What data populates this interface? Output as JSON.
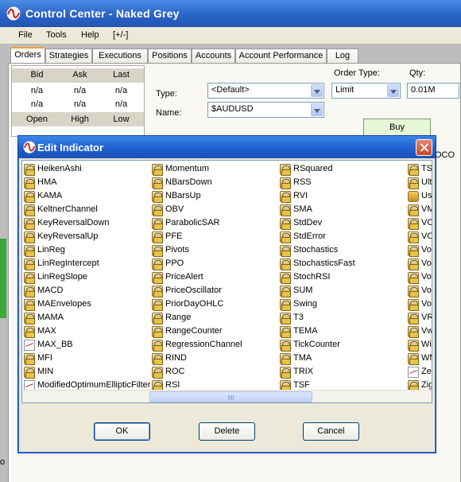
{
  "app": {
    "title": "Control Center - Naked Grey"
  },
  "menu": [
    "File",
    "Tools",
    "Help",
    "[+/-]"
  ],
  "tabs": [
    "Orders",
    "Strategies",
    "Executions",
    "Positions",
    "Accounts",
    "Account Performance",
    "Log"
  ],
  "quote": {
    "headers_top": [
      "Bid",
      "Ask",
      "Last"
    ],
    "values_top": [
      "n/a",
      "n/a",
      "n/a"
    ],
    "values_mid": [
      "n/a",
      "n/a",
      "n/a"
    ],
    "headers_bottom": [
      "Open",
      "High",
      "Low"
    ]
  },
  "order": {
    "type_label": "Type:",
    "type_value": "<Default>",
    "name_label": "Name:",
    "name_value": "$AUDUSD",
    "order_type_label": "Order Type:",
    "order_type_value": "Limit",
    "qty_label": "Qty:",
    "qty_value": "0.01M",
    "buy_label": "Buy",
    "oco_label": "OCO"
  },
  "dialog": {
    "title": "Edit Indicator",
    "columns": [
      [
        {
          "label": "HeikenAshi",
          "icon": "lock-icon"
        },
        {
          "label": "HMA",
          "icon": "lock-icon"
        },
        {
          "label": "KAMA",
          "icon": "lock-icon"
        },
        {
          "label": "KeltnerChannel",
          "icon": "lock-icon"
        },
        {
          "label": "KeyReversalDown",
          "icon": "lock-icon"
        },
        {
          "label": "KeyReversalUp",
          "icon": "lock-icon"
        },
        {
          "label": "LinReg",
          "icon": "lock-icon"
        },
        {
          "label": "LinRegIntercept",
          "icon": "lock-icon"
        },
        {
          "label": "LinRegSlope",
          "icon": "lock-icon"
        },
        {
          "label": "MACD",
          "icon": "lock-icon"
        },
        {
          "label": "MAEnvelopes",
          "icon": "lock-icon"
        },
        {
          "label": "MAMA",
          "icon": "lock-icon"
        },
        {
          "label": "MAX",
          "icon": "lock-icon"
        },
        {
          "label": "MAX_BB",
          "icon": "chart-icon"
        },
        {
          "label": "MFI",
          "icon": "lock-icon"
        },
        {
          "label": "MIN",
          "icon": "lock-icon"
        },
        {
          "label": "ModifiedOptimumEllipticFilter",
          "icon": "chart-icon"
        }
      ],
      [
        {
          "label": "Momentum",
          "icon": "lock-icon"
        },
        {
          "label": "NBarsDown",
          "icon": "lock-icon"
        },
        {
          "label": "NBarsUp",
          "icon": "lock-icon"
        },
        {
          "label": "OBV",
          "icon": "lock-icon"
        },
        {
          "label": "ParabolicSAR",
          "icon": "lock-icon"
        },
        {
          "label": "PFE",
          "icon": "lock-icon"
        },
        {
          "label": "Pivots",
          "icon": "lock-icon"
        },
        {
          "label": "PPO",
          "icon": "lock-icon"
        },
        {
          "label": "PriceAlert",
          "icon": "lock-icon"
        },
        {
          "label": "PriceOscillator",
          "icon": "lock-icon"
        },
        {
          "label": "PriorDayOHLC",
          "icon": "lock-icon"
        },
        {
          "label": "Range",
          "icon": "lock-icon"
        },
        {
          "label": "RangeCounter",
          "icon": "lock-icon"
        },
        {
          "label": "RegressionChannel",
          "icon": "lock-icon"
        },
        {
          "label": "RIND",
          "icon": "lock-icon"
        },
        {
          "label": "ROC",
          "icon": "lock-icon"
        },
        {
          "label": "RSI",
          "icon": "lock-icon"
        }
      ],
      [
        {
          "label": "RSquared",
          "icon": "lock-icon"
        },
        {
          "label": "RSS",
          "icon": "lock-icon"
        },
        {
          "label": "RVI",
          "icon": "lock-icon"
        },
        {
          "label": "SMA",
          "icon": "lock-icon"
        },
        {
          "label": "StdDev",
          "icon": "lock-icon"
        },
        {
          "label": "StdError",
          "icon": "lock-icon"
        },
        {
          "label": "Stochastics",
          "icon": "lock-icon"
        },
        {
          "label": "StochasticsFast",
          "icon": "lock-icon"
        },
        {
          "label": "StochRSI",
          "icon": "lock-icon"
        },
        {
          "label": "SUM",
          "icon": "lock-icon"
        },
        {
          "label": "Swing",
          "icon": "lock-icon"
        },
        {
          "label": "T3",
          "icon": "lock-icon"
        },
        {
          "label": "TEMA",
          "icon": "lock-icon"
        },
        {
          "label": "TickCounter",
          "icon": "lock-icon"
        },
        {
          "label": "TMA",
          "icon": "lock-icon"
        },
        {
          "label": "TRIX",
          "icon": "lock-icon"
        },
        {
          "label": "TSF",
          "icon": "lock-icon"
        }
      ],
      [
        {
          "label": "TSI",
          "icon": "lock-icon"
        },
        {
          "label": "Ulti",
          "icon": "lock-icon"
        },
        {
          "label": "Use",
          "icon": "user-icon"
        },
        {
          "label": "VM",
          "icon": "lock-icon"
        },
        {
          "label": "VO",
          "icon": "lock-icon"
        },
        {
          "label": "VO",
          "icon": "lock-icon"
        },
        {
          "label": "Vol",
          "icon": "lock-icon"
        },
        {
          "label": "Vol",
          "icon": "lock-icon"
        },
        {
          "label": "Vol",
          "icon": "lock-icon"
        },
        {
          "label": "Vol",
          "icon": "lock-icon"
        },
        {
          "label": "Vol",
          "icon": "lock-icon"
        },
        {
          "label": "VR",
          "icon": "lock-icon"
        },
        {
          "label": "Vw",
          "icon": "lock-icon"
        },
        {
          "label": "Wil",
          "icon": "lock-icon"
        },
        {
          "label": "WM",
          "icon": "lock-icon"
        },
        {
          "label": "Zer",
          "icon": "chart-icon"
        },
        {
          "label": "Zig",
          "icon": "lock-icon"
        }
      ]
    ],
    "ok_label": "OK",
    "delete_label": "Delete",
    "cancel_label": "Cancel"
  },
  "colors": {
    "title_blue": "#2a64c8",
    "tab_accent": "#f2a53b",
    "buy_green": "#e6f7d8"
  }
}
